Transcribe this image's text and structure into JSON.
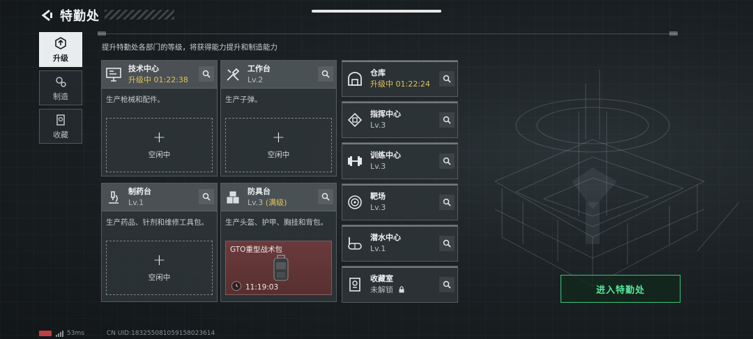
{
  "header": {
    "title": "特勤处"
  },
  "nav": {
    "tabs": [
      {
        "label": "升级",
        "icon": "upgrade-icon",
        "active": true
      },
      {
        "label": "制造",
        "icon": "gears-icon",
        "active": false
      },
      {
        "label": "收藏",
        "icon": "collection-icon",
        "active": false
      }
    ]
  },
  "subtitle": "提升特勤处各部门的等级，将获得能力提升和制造能力",
  "cards": [
    {
      "name": "技术中心",
      "status": "升级中 01:22:38",
      "desc": "生产枪械和配件。",
      "slot": {
        "plus": "+",
        "label": "空闲中"
      },
      "icon": "monitor-icon"
    },
    {
      "name": "工作台",
      "status": "Lv.2",
      "desc": "生产子弹。",
      "slot": {
        "plus": "+",
        "label": "空闲中"
      },
      "icon": "tools-icon"
    },
    {
      "name": "制药台",
      "status": "Lv.1",
      "desc": "生产药品、针剂和维修工具包。",
      "slot": {
        "plus": "+",
        "label": "空闲中"
      },
      "icon": "microscope-icon"
    },
    {
      "name": "防具台",
      "status": "Lv.3",
      "status_extra": "(满级)",
      "desc": "生产头盔、护甲、胸挂和背包。",
      "production": {
        "item": "GTO重型战术包",
        "time": "11:19:03"
      },
      "icon": "armor-icon"
    }
  ],
  "departments": [
    {
      "name": "仓库",
      "status": "升级中 01:22:24",
      "icon": "warehouse-icon"
    },
    {
      "name": "指挥中心",
      "status": "Lv.3",
      "icon": "chip-icon"
    },
    {
      "name": "训练中心",
      "status": "Lv.3",
      "icon": "dumbbell-icon"
    },
    {
      "name": "靶场",
      "status": "Lv.3",
      "icon": "target-icon"
    },
    {
      "name": "潜水中心",
      "status": "Lv.1",
      "icon": "diving-mask-icon"
    },
    {
      "name": "收藏室",
      "status": "未解锁",
      "icon": "trophy-icon"
    }
  ],
  "enter_button": "进入特勤处",
  "footer": {
    "ping": "53ms",
    "uid": "CN UID:18325508105915802361​4"
  },
  "colors": {
    "upgrading": "#e2c25a",
    "accent_green": "#37c77a",
    "battery_red": "#c04040"
  }
}
